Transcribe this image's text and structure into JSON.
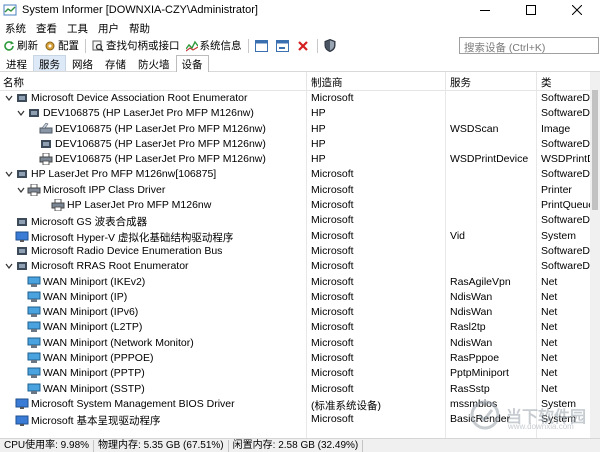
{
  "window": {
    "title": "System Informer [DOWNXIA-CZY\\Administrator]"
  },
  "menu": [
    "系统",
    "查看",
    "工具",
    "用户",
    "帮助"
  ],
  "toolbar": {
    "refresh": "刷新",
    "options": "配置",
    "find_handles": "查找句柄或接口",
    "sysinfo": "系统信息",
    "search_placeholder": "搜索设备 (Ctrl+K)"
  },
  "tabs": [
    "进程",
    "服务",
    "网络",
    "存储",
    "防火墙",
    "设备"
  ],
  "columns": {
    "name": "名称",
    "manufacturer": "制造商",
    "service": "服务",
    "class": "类"
  },
  "rows": [
    {
      "name": "Microsoft Device Association Root Enumerator",
      "manufacturer": "Microsoft",
      "service": "",
      "class": "SoftwareD"
    },
    {
      "name": "DEV106875 (HP LaserJet Pro MFP M126nw)",
      "manufacturer": "HP",
      "service": "",
      "class": "SoftwareD"
    },
    {
      "name": "DEV106875 (HP LaserJet Pro MFP M126nw)",
      "manufacturer": "HP",
      "service": "WSDScan",
      "class": "Image"
    },
    {
      "name": "DEV106875 (HP LaserJet Pro MFP M126nw)",
      "manufacturer": "HP",
      "service": "",
      "class": "SoftwareD"
    },
    {
      "name": "DEV106875 (HP LaserJet Pro MFP M126nw)",
      "manufacturer": "HP",
      "service": "WSDPrintDevice",
      "class": "WSDPrintD"
    },
    {
      "name": "HP LaserJet Pro MFP M126nw[106875]",
      "manufacturer": "Microsoft",
      "service": "",
      "class": "SoftwareD"
    },
    {
      "name": "Microsoft IPP Class Driver",
      "manufacturer": "Microsoft",
      "service": "",
      "class": "Printer"
    },
    {
      "name": "HP LaserJet Pro MFP M126nw",
      "manufacturer": "Microsoft",
      "service": "",
      "class": "PrintQueue"
    },
    {
      "name": "Microsoft GS 波表合成器",
      "manufacturer": "Microsoft",
      "service": "",
      "class": "SoftwareD"
    },
    {
      "name": "Microsoft Hyper-V 虚拟化基础结构驱动程序",
      "manufacturer": "Microsoft",
      "service": "Vid",
      "class": "System"
    },
    {
      "name": "Microsoft Radio Device Enumeration Bus",
      "manufacturer": "Microsoft",
      "service": "",
      "class": "SoftwareD"
    },
    {
      "name": "Microsoft RRAS Root Enumerator",
      "manufacturer": "Microsoft",
      "service": "",
      "class": "SoftwareD"
    },
    {
      "name": "WAN Miniport (IKEv2)",
      "manufacturer": "Microsoft",
      "service": "RasAgileVpn",
      "class": "Net"
    },
    {
      "name": "WAN Miniport (IP)",
      "manufacturer": "Microsoft",
      "service": "NdisWan",
      "class": "Net"
    },
    {
      "name": "WAN Miniport (IPv6)",
      "manufacturer": "Microsoft",
      "service": "NdisWan",
      "class": "Net"
    },
    {
      "name": "WAN Miniport (L2TP)",
      "manufacturer": "Microsoft",
      "service": "Rasl2tp",
      "class": "Net"
    },
    {
      "name": "WAN Miniport (Network Monitor)",
      "manufacturer": "Microsoft",
      "service": "NdisWan",
      "class": "Net"
    },
    {
      "name": "WAN Miniport (PPPOE)",
      "manufacturer": "Microsoft",
      "service": "RasPppoe",
      "class": "Net"
    },
    {
      "name": "WAN Miniport (PPTP)",
      "manufacturer": "Microsoft",
      "service": "PptpMiniport",
      "class": "Net"
    },
    {
      "name": "WAN Miniport (SSTP)",
      "manufacturer": "Microsoft",
      "service": "RasSstp",
      "class": "Net"
    },
    {
      "name": "Microsoft System Management BIOS Driver",
      "manufacturer": "(标准系统设备)",
      "service": "mssmbios",
      "class": "System"
    },
    {
      "name": "Microsoft 基本呈现驱动程序",
      "manufacturer": "Microsoft",
      "service": "BasicRender",
      "class": "System"
    }
  ],
  "status": {
    "cpu": "CPU使用率: 9.98%",
    "physical": "物理内存: 5.35 GB (67.51%)",
    "free": "闲置内存: 2.58 GB (32.49%)"
  },
  "watermark": {
    "text": "当下软件园",
    "url": "www.downxia.com"
  }
}
